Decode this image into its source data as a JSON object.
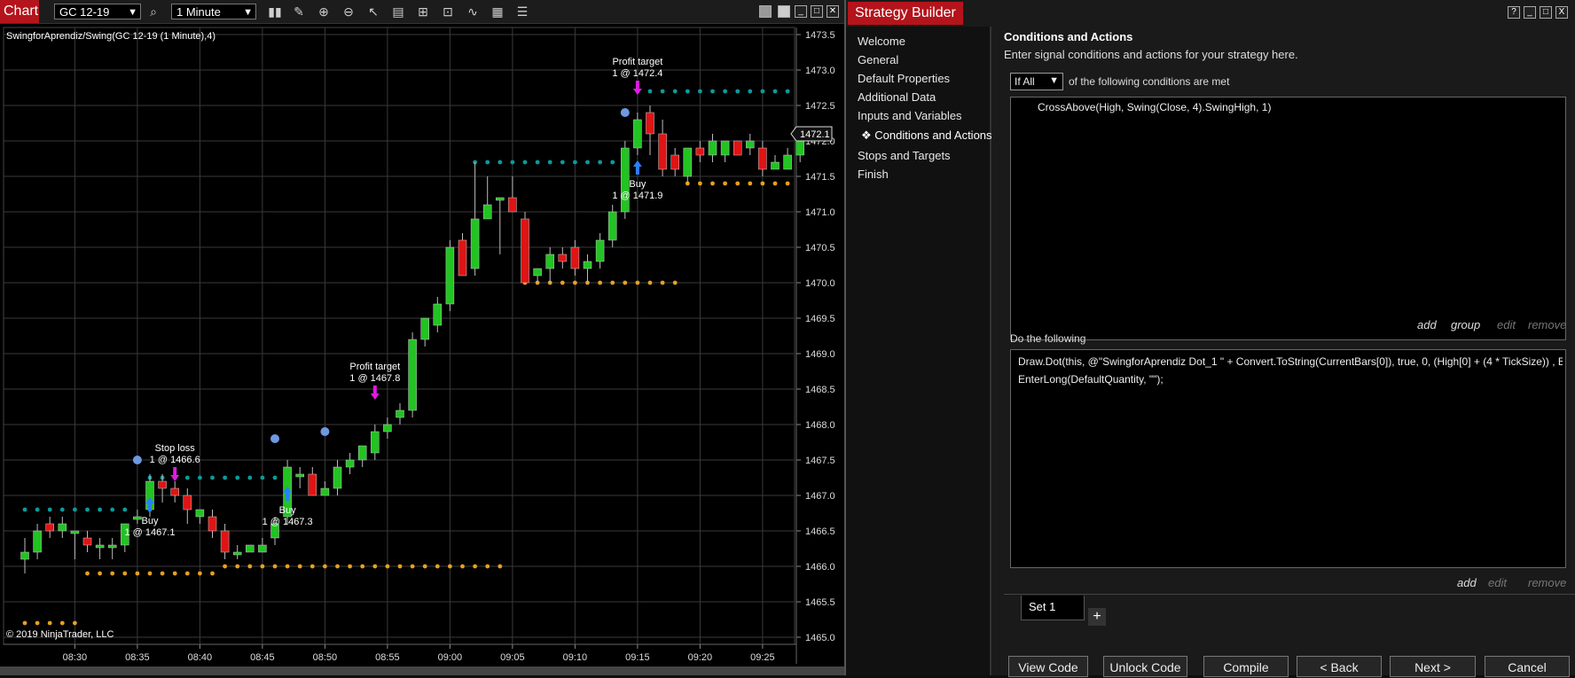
{
  "chart_window": {
    "tab_label": "Chart",
    "instrument": "GC 12-19",
    "interval": "1 Minute",
    "indicator_label": "SwingforAprendiz/Swing(GC 12-19 (1 Minute),4)",
    "copyright": "© 2019 NinjaTrader, LLC",
    "price_marker": "1472.1",
    "toolbar_icons": [
      "search-icon",
      "bar-type-icon",
      "pencil-icon",
      "zoom-in-icon",
      "zoom-out-icon",
      "pointer-icon",
      "data-box-icon",
      "chart-trader-icon",
      "screenshot-icon",
      "indicators-icon",
      "strategies-icon",
      "properties-icon"
    ],
    "colors": {
      "up": "#22c322",
      "down": "#e01414",
      "swing_high": "#0a9c9c",
      "swing_low": "#e6a01e",
      "marker": "#e01be0",
      "buy_arrow": "#2a7fff",
      "dot": "#6f98e0"
    }
  },
  "chart_data": {
    "type": "candlestick",
    "title": "SwingforAprendiz/Swing(GC 12-19 (1 Minute),4)",
    "ylim": [
      1464.9,
      1473.6
    ],
    "y_ticks": [
      "1473.5",
      "1473.0",
      "1472.5",
      "1472.0",
      "1471.5",
      "1471.0",
      "1470.5",
      "1470.0",
      "1469.5",
      "1469.0",
      "1468.5",
      "1468.0",
      "1467.5",
      "1467.0",
      "1466.5",
      "1466.0",
      "1465.5",
      "1465.0"
    ],
    "x_ticks": [
      "08:30",
      "08:35",
      "08:40",
      "08:45",
      "08:50",
      "08:55",
      "09:00",
      "09:05",
      "09:10",
      "09:15",
      "09:20",
      "09:25"
    ],
    "first_bar_time": "08:26",
    "grid": true,
    "candles": [
      {
        "o": 1466.1,
        "h": 1466.4,
        "l": 1465.9,
        "c": 1466.2
      },
      {
        "o": 1466.2,
        "h": 1466.6,
        "l": 1466.1,
        "c": 1466.5
      },
      {
        "o": 1466.6,
        "h": 1466.7,
        "l": 1466.4,
        "c": 1466.5
      },
      {
        "o": 1466.5,
        "h": 1466.7,
        "l": 1466.4,
        "c": 1466.6
      },
      {
        "o": 1466.5,
        "h": 1466.5,
        "l": 1466.1,
        "c": 1466.5
      },
      {
        "o": 1466.4,
        "h": 1466.5,
        "l": 1466.2,
        "c": 1466.3
      },
      {
        "o": 1466.3,
        "h": 1466.4,
        "l": 1466.1,
        "c": 1466.3
      },
      {
        "o": 1466.3,
        "h": 1466.4,
        "l": 1466.1,
        "c": 1466.3
      },
      {
        "o": 1466.3,
        "h": 1466.6,
        "l": 1466.2,
        "c": 1466.6
      },
      {
        "o": 1466.7,
        "h": 1466.8,
        "l": 1466.6,
        "c": 1466.7
      },
      {
        "o": 1466.8,
        "h": 1467.3,
        "l": 1466.7,
        "c": 1467.2
      },
      {
        "o": 1467.2,
        "h": 1467.3,
        "l": 1466.9,
        "c": 1467.1
      },
      {
        "o": 1467.1,
        "h": 1467.2,
        "l": 1466.9,
        "c": 1467.0
      },
      {
        "o": 1467.0,
        "h": 1467.1,
        "l": 1466.6,
        "c": 1466.8
      },
      {
        "o": 1466.7,
        "h": 1466.8,
        "l": 1466.6,
        "c": 1466.8
      },
      {
        "o": 1466.7,
        "h": 1466.8,
        "l": 1466.4,
        "c": 1466.5
      },
      {
        "o": 1466.5,
        "h": 1466.6,
        "l": 1466.1,
        "c": 1466.2
      },
      {
        "o": 1466.2,
        "h": 1466.3,
        "l": 1466.1,
        "c": 1466.2
      },
      {
        "o": 1466.2,
        "h": 1466.3,
        "l": 1466.2,
        "c": 1466.3
      },
      {
        "o": 1466.2,
        "h": 1466.4,
        "l": 1466.2,
        "c": 1466.3
      },
      {
        "o": 1466.4,
        "h": 1466.7,
        "l": 1466.3,
        "c": 1466.6
      },
      {
        "o": 1466.7,
        "h": 1467.5,
        "l": 1466.6,
        "c": 1467.4
      },
      {
        "o": 1467.3,
        "h": 1467.4,
        "l": 1467.1,
        "c": 1467.3
      },
      {
        "o": 1467.3,
        "h": 1467.4,
        "l": 1467.0,
        "c": 1467.0
      },
      {
        "o": 1467.0,
        "h": 1467.2,
        "l": 1467.0,
        "c": 1467.1
      },
      {
        "o": 1467.1,
        "h": 1467.5,
        "l": 1467.0,
        "c": 1467.4
      },
      {
        "o": 1467.4,
        "h": 1467.6,
        "l": 1467.3,
        "c": 1467.5
      },
      {
        "o": 1467.5,
        "h": 1467.7,
        "l": 1467.4,
        "c": 1467.7
      },
      {
        "o": 1467.6,
        "h": 1468.0,
        "l": 1467.5,
        "c": 1467.9
      },
      {
        "o": 1467.9,
        "h": 1468.1,
        "l": 1467.8,
        "c": 1468.0
      },
      {
        "o": 1468.1,
        "h": 1468.3,
        "l": 1468.0,
        "c": 1468.2
      },
      {
        "o": 1468.2,
        "h": 1469.3,
        "l": 1468.1,
        "c": 1469.2
      },
      {
        "o": 1469.2,
        "h": 1469.5,
        "l": 1469.1,
        "c": 1469.5
      },
      {
        "o": 1469.4,
        "h": 1469.8,
        "l": 1469.3,
        "c": 1469.7
      },
      {
        "o": 1469.7,
        "h": 1470.6,
        "l": 1469.6,
        "c": 1470.5
      },
      {
        "o": 1470.6,
        "h": 1470.7,
        "l": 1470.1,
        "c": 1470.1
      },
      {
        "o": 1470.2,
        "h": 1471.7,
        "l": 1470.1,
        "c": 1470.9
      },
      {
        "o": 1470.9,
        "h": 1471.5,
        "l": 1470.9,
        "c": 1471.1
      },
      {
        "o": 1471.2,
        "h": 1471.2,
        "l": 1470.4,
        "c": 1471.2
      },
      {
        "o": 1471.2,
        "h": 1471.5,
        "l": 1471.0,
        "c": 1471.0
      },
      {
        "o": 1470.9,
        "h": 1471.0,
        "l": 1470.0,
        "c": 1470.0
      },
      {
        "o": 1470.1,
        "h": 1470.2,
        "l": 1470.0,
        "c": 1470.2
      },
      {
        "o": 1470.2,
        "h": 1470.5,
        "l": 1470.0,
        "c": 1470.4
      },
      {
        "o": 1470.4,
        "h": 1470.5,
        "l": 1470.2,
        "c": 1470.3
      },
      {
        "o": 1470.5,
        "h": 1470.6,
        "l": 1470.1,
        "c": 1470.2
      },
      {
        "o": 1470.2,
        "h": 1470.4,
        "l": 1470.0,
        "c": 1470.3
      },
      {
        "o": 1470.3,
        "h": 1470.7,
        "l": 1470.2,
        "c": 1470.6
      },
      {
        "o": 1470.6,
        "h": 1471.1,
        "l": 1470.5,
        "c": 1471.0
      },
      {
        "o": 1471.0,
        "h": 1472.0,
        "l": 1470.9,
        "c": 1471.9
      },
      {
        "o": 1471.9,
        "h": 1472.4,
        "l": 1471.8,
        "c": 1472.3
      },
      {
        "o": 1472.4,
        "h": 1472.5,
        "l": 1471.8,
        "c": 1472.1
      },
      {
        "o": 1472.1,
        "h": 1472.3,
        "l": 1471.5,
        "c": 1471.6
      },
      {
        "o": 1471.8,
        "h": 1471.9,
        "l": 1471.5,
        "c": 1471.6
      },
      {
        "o": 1471.5,
        "h": 1471.9,
        "l": 1471.4,
        "c": 1471.9
      },
      {
        "o": 1471.9,
        "h": 1472.0,
        "l": 1471.7,
        "c": 1471.8
      },
      {
        "o": 1471.8,
        "h": 1472.1,
        "l": 1471.7,
        "c": 1472.0
      },
      {
        "o": 1471.8,
        "h": 1472.0,
        "l": 1471.7,
        "c": 1472.0
      },
      {
        "o": 1472.0,
        "h": 1472.0,
        "l": 1471.8,
        "c": 1471.8
      },
      {
        "o": 1471.9,
        "h": 1472.1,
        "l": 1471.8,
        "c": 1472.0
      },
      {
        "o": 1471.9,
        "h": 1472.0,
        "l": 1471.5,
        "c": 1471.6
      },
      {
        "o": 1471.6,
        "h": 1471.8,
        "l": 1471.6,
        "c": 1471.7
      },
      {
        "o": 1471.6,
        "h": 1471.9,
        "l": 1471.6,
        "c": 1471.8
      },
      {
        "o": 1471.8,
        "h": 1472.2,
        "l": 1471.7,
        "c": 1472.1
      }
    ],
    "swing_lines": [
      {
        "kind": "high",
        "price": 1466.8,
        "from": 0,
        "to": 8
      },
      {
        "kind": "high",
        "price": 1467.25,
        "from": 10,
        "to": 20
      },
      {
        "kind": "high",
        "price": 1471.7,
        "from": 36,
        "to": 48
      },
      {
        "kind": "high",
        "price": 1472.7,
        "from": 49,
        "to": 61
      },
      {
        "kind": "low",
        "price": 1465.2,
        "from": 0,
        "to": 4
      },
      {
        "kind": "low",
        "price": 1465.9,
        "from": 5,
        "to": 15
      },
      {
        "kind": "low",
        "price": 1466.0,
        "from": 16,
        "to": 38
      },
      {
        "kind": "low",
        "price": 1470.0,
        "from": 40,
        "to": 52
      },
      {
        "kind": "low",
        "price": 1471.4,
        "from": 53,
        "to": 61
      }
    ],
    "signal_dots": [
      {
        "bar": 9,
        "price": 1467.5
      },
      {
        "bar": 20,
        "price": 1467.8
      },
      {
        "bar": 24,
        "price": 1467.9
      },
      {
        "bar": 48,
        "price": 1472.4
      }
    ],
    "annotations": [
      {
        "bar": 10,
        "price": 1466.85,
        "kind": "entry",
        "arrow": "buy",
        "label": [
          "Buy",
          "1 @ 1467.1"
        ],
        "label_pos": "below"
      },
      {
        "bar": 12,
        "price": 1467.3,
        "kind": "exit",
        "label": [
          "Stop loss",
          "1 @ 1466.6"
        ],
        "label_pos": "above"
      },
      {
        "bar": 21,
        "price": 1467.0,
        "kind": "entry",
        "arrow": "buy",
        "label": [
          "Buy",
          "1 @ 1467.3"
        ],
        "label_pos": "below"
      },
      {
        "bar": 28,
        "price": 1468.45,
        "kind": "exit",
        "label": [
          "Profit target",
          "1 @ 1467.8"
        ],
        "label_pos": "above"
      },
      {
        "bar": 49,
        "price": 1471.6,
        "kind": "entry",
        "arrow": "buy",
        "label": [
          "Buy",
          "1 @ 1471.9"
        ],
        "label_pos": "below"
      },
      {
        "bar": 49,
        "price": 1472.75,
        "kind": "exit",
        "label": [
          "Profit target",
          "1 @ 1472.4"
        ],
        "label_pos": "above"
      }
    ]
  },
  "strategy_builder": {
    "title": "Strategy Builder",
    "nav": [
      "Welcome",
      "General",
      "Default Properties",
      "Additional Data",
      "Inputs and Variables",
      "Conditions and Actions",
      "Stops and Targets",
      "Finish"
    ],
    "active_nav_index": 5,
    "active_bullet": "❖",
    "header": "Conditions and Actions",
    "description": "Enter signal conditions and actions for your strategy here.",
    "condition_mode": "If All",
    "condition_text": "of the following conditions are met",
    "conditions": [
      "CrossAbove(High, Swing(Close, 4).SwingHigh, 1)"
    ],
    "condition_links": [
      "add",
      "group",
      "edit",
      "remove"
    ],
    "do_label": "Do the following",
    "actions": [
      "Draw.Dot(this, @\"SwingforAprendiz Dot_1 \" + Convert.ToString(CurrentBars[0]), true, 0, (High[0] + (4 * TickSize)) , B",
      "EnterLong(DefaultQuantity, \"\");"
    ],
    "action_links": [
      "add",
      "edit",
      "remove"
    ],
    "set_tab": "Set 1",
    "add_set": "+",
    "buttons": [
      "View Code",
      "Unlock Code",
      "Compile",
      "< Back",
      "Next >",
      "Cancel"
    ],
    "window_controls": [
      "?",
      "_",
      "□",
      "X"
    ]
  }
}
